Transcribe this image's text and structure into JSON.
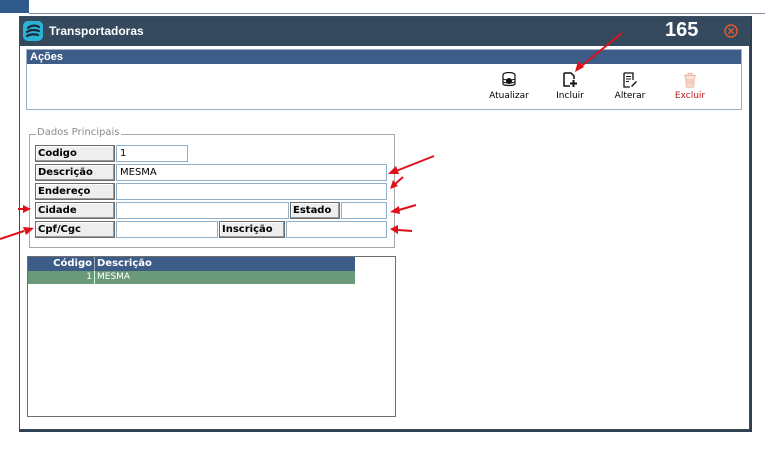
{
  "window": {
    "title": "Transportadoras",
    "number": "165"
  },
  "acoes": {
    "title": "Ações",
    "buttons": {
      "atualizar": "Atualizar",
      "incluir": "Incluir",
      "alterar": "Alterar",
      "excluir": "Excluir"
    }
  },
  "dados_principais": {
    "legend": "Dados Principais",
    "labels": {
      "codigo": "Codigo",
      "descricao": "Descrição",
      "endereco": "Endereço",
      "cidade": "Cidade",
      "estado": "Estado",
      "cpf_cgc": "Cpf/Cgc",
      "inscricao": "Inscrição"
    },
    "values": {
      "codigo": "1",
      "descricao": "MESMA",
      "endereco": "",
      "cidade": "",
      "estado": "",
      "cpf_cgc": "",
      "inscricao": ""
    }
  },
  "grid": {
    "columns": [
      "Código",
      "Descrição"
    ],
    "rows": [
      {
        "codigo": "1",
        "descricao": "MESMA"
      }
    ]
  },
  "icons": {
    "app": "app-logo-icon",
    "close": "close-icon",
    "atualizar": "database-refresh-icon",
    "incluir": "add-document-icon",
    "alterar": "edit-document-icon",
    "excluir": "trash-icon"
  },
  "colors": {
    "titlebar": "#34495e",
    "header": "#3d5c88",
    "selected_row": "#6b9a7a",
    "annotation_arrow": "#e0101a",
    "excluir_label": "#c0181c"
  }
}
